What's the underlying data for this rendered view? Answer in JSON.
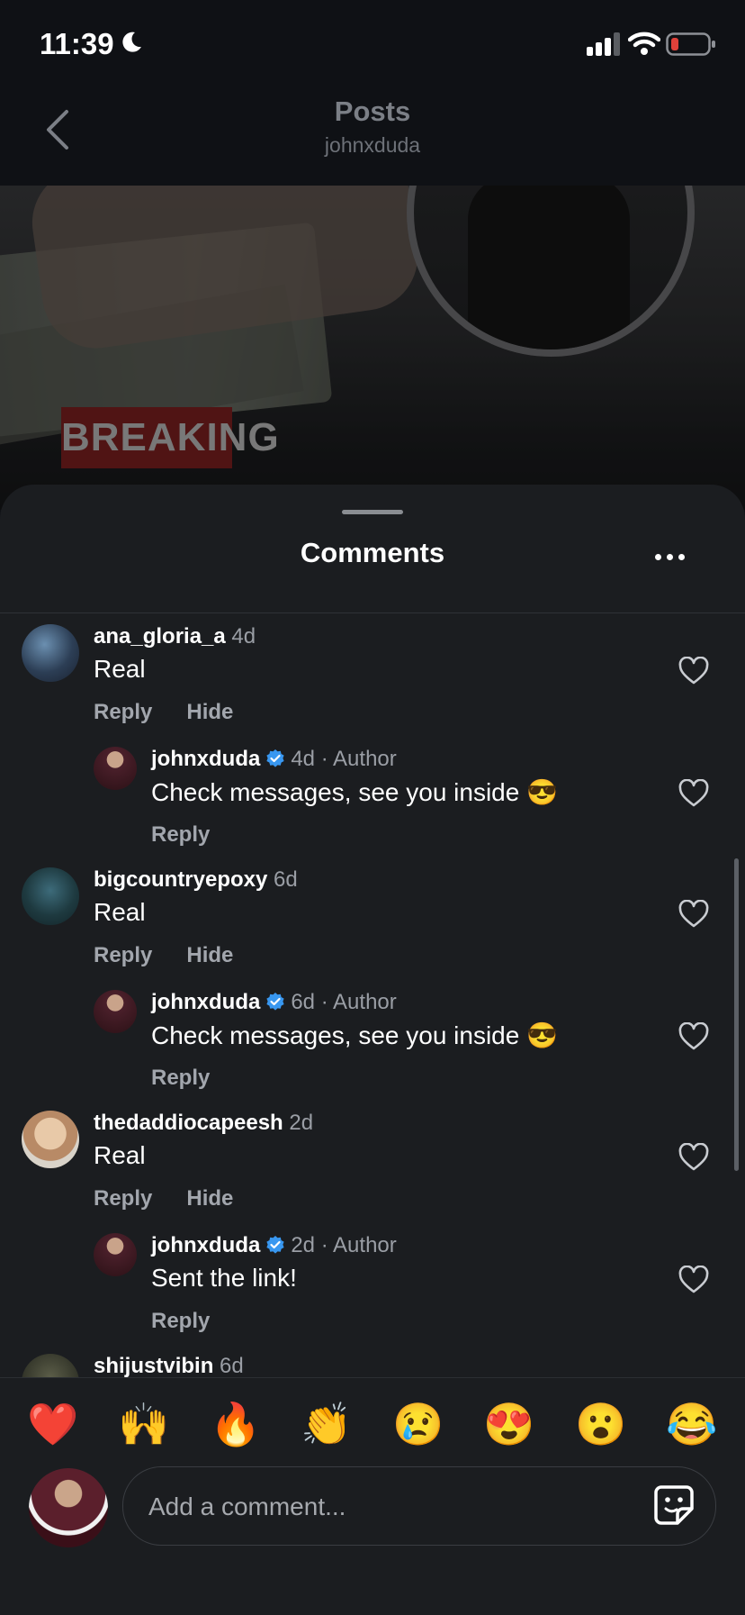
{
  "status_bar": {
    "time": "11:39"
  },
  "nav": {
    "title": "Posts",
    "subtitle": "johnxduda"
  },
  "post": {
    "badge": "BREAKING"
  },
  "sheet": {
    "title": "Comments"
  },
  "comments": [
    {
      "username": "ana_gloria_a",
      "time": "4d",
      "text": "Real",
      "reply_label": "Reply",
      "hide_label": "Hide"
    },
    {
      "username": "johnxduda",
      "time": "4d",
      "author_label": "· Author",
      "text": "Check messages, see you inside 😎",
      "reply_label": "Reply"
    },
    {
      "username": "bigcountryepoxy",
      "time": "6d",
      "text": "Real",
      "reply_label": "Reply",
      "hide_label": "Hide"
    },
    {
      "username": "johnxduda",
      "time": "6d",
      "author_label": "· Author",
      "text": "Check messages, see you inside 😎",
      "reply_label": "Reply"
    },
    {
      "username": "thedaddiocapeesh",
      "time": "2d",
      "text": "Real",
      "reply_label": "Reply",
      "hide_label": "Hide"
    },
    {
      "username": "johnxduda",
      "time": "2d",
      "author_label": "· Author",
      "text": "Sent the link!",
      "reply_label": "Reply"
    },
    {
      "username": "shijustvibin",
      "time": "6d"
    }
  ],
  "quick_reactions": [
    "❤️",
    "🙌",
    "🔥",
    "👏",
    "😢",
    "😍",
    "😮",
    "😂"
  ],
  "composer": {
    "placeholder": "Add a comment..."
  },
  "icons": {
    "verified": "verified-badge-icon",
    "heart": "heart-outline-icon",
    "back": "chevron-left-icon",
    "more": "more-horizontal-icon",
    "sticker": "sticker-icon"
  },
  "colors": {
    "verified": "#3897f0",
    "background": "#1b1d20",
    "battery_low": "#e0413a"
  }
}
